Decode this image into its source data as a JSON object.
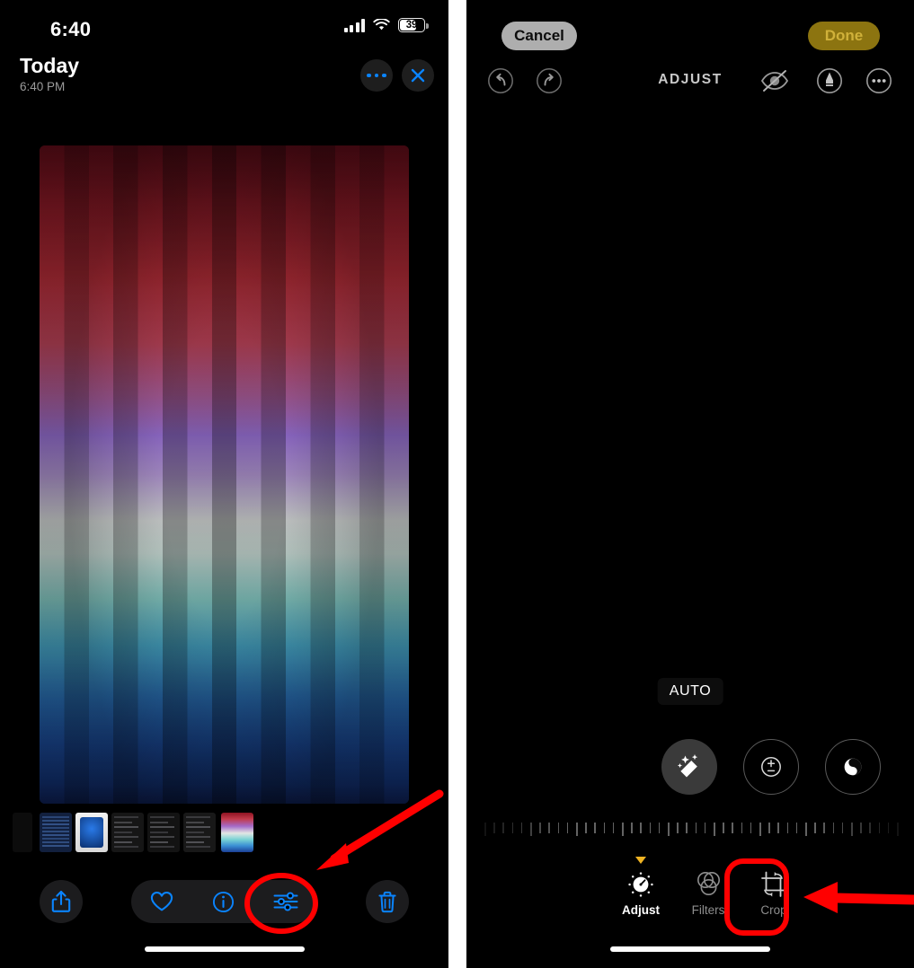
{
  "left_panel": {
    "status_bar": {
      "time": "6:40",
      "battery_level": "39",
      "signal_icon": "cellular-signal-icon",
      "wifi_icon": "wifi-icon",
      "battery_icon": "battery-icon"
    },
    "header": {
      "title": "Today",
      "subtitle": "6:40 PM",
      "more_icon": "more-dots-icon",
      "close_icon": "close-x-icon"
    },
    "photo": {
      "name": "gradient-stripes-photo"
    },
    "filmstrip": {
      "name": "photo-filmstrip",
      "selected_index": 6,
      "thumb_count": 7
    },
    "toolbar": {
      "share_icon": "share-icon",
      "favorite_icon": "heart-icon",
      "info_icon": "info-circle-icon",
      "adjust_icon": "sliders-adjust-icon",
      "delete_icon": "trash-icon"
    }
  },
  "right_panel": {
    "header": {
      "cancel_label": "Cancel",
      "done_label": "Done",
      "title": "ADJUST",
      "undo_icon": "undo-arrow-icon",
      "redo_icon": "redo-arrow-icon",
      "hide_icon": "eye-slash-icon",
      "markup_icon": "markup-pen-icon",
      "more_icon": "more-dots-circle-icon"
    },
    "photo": {
      "name": "gradient-stripes-photo",
      "badge": "AUTO"
    },
    "adjust_circles": [
      {
        "name": "auto-enhance-button",
        "icon": "magic-wand-icon",
        "active": true
      },
      {
        "name": "exposure-button",
        "icon": "exposure-plus-minus-icon",
        "active": false
      },
      {
        "name": "brilliance-button",
        "icon": "brilliance-half-circle-icon",
        "active": false
      }
    ],
    "slider": {
      "name": "intensity-ruler-slider"
    },
    "tabs": [
      {
        "label": "Adjust",
        "icon": "adjust-dial-icon",
        "state": "active"
      },
      {
        "label": "Filters",
        "icon": "filters-circles-icon",
        "state": "idle"
      },
      {
        "label": "Crop",
        "icon": "crop-rotate-icon",
        "state": "idle"
      }
    ]
  },
  "annotations": {
    "color": "#ff0000",
    "items": [
      {
        "name": "highlight-adjust-button",
        "shape": "ellipse"
      },
      {
        "name": "arrow-to-adjust-button",
        "shape": "arrow"
      },
      {
        "name": "highlight-crop-tab",
        "shape": "rounded-rect"
      },
      {
        "name": "arrow-to-crop-tab",
        "shape": "arrow"
      }
    ]
  }
}
